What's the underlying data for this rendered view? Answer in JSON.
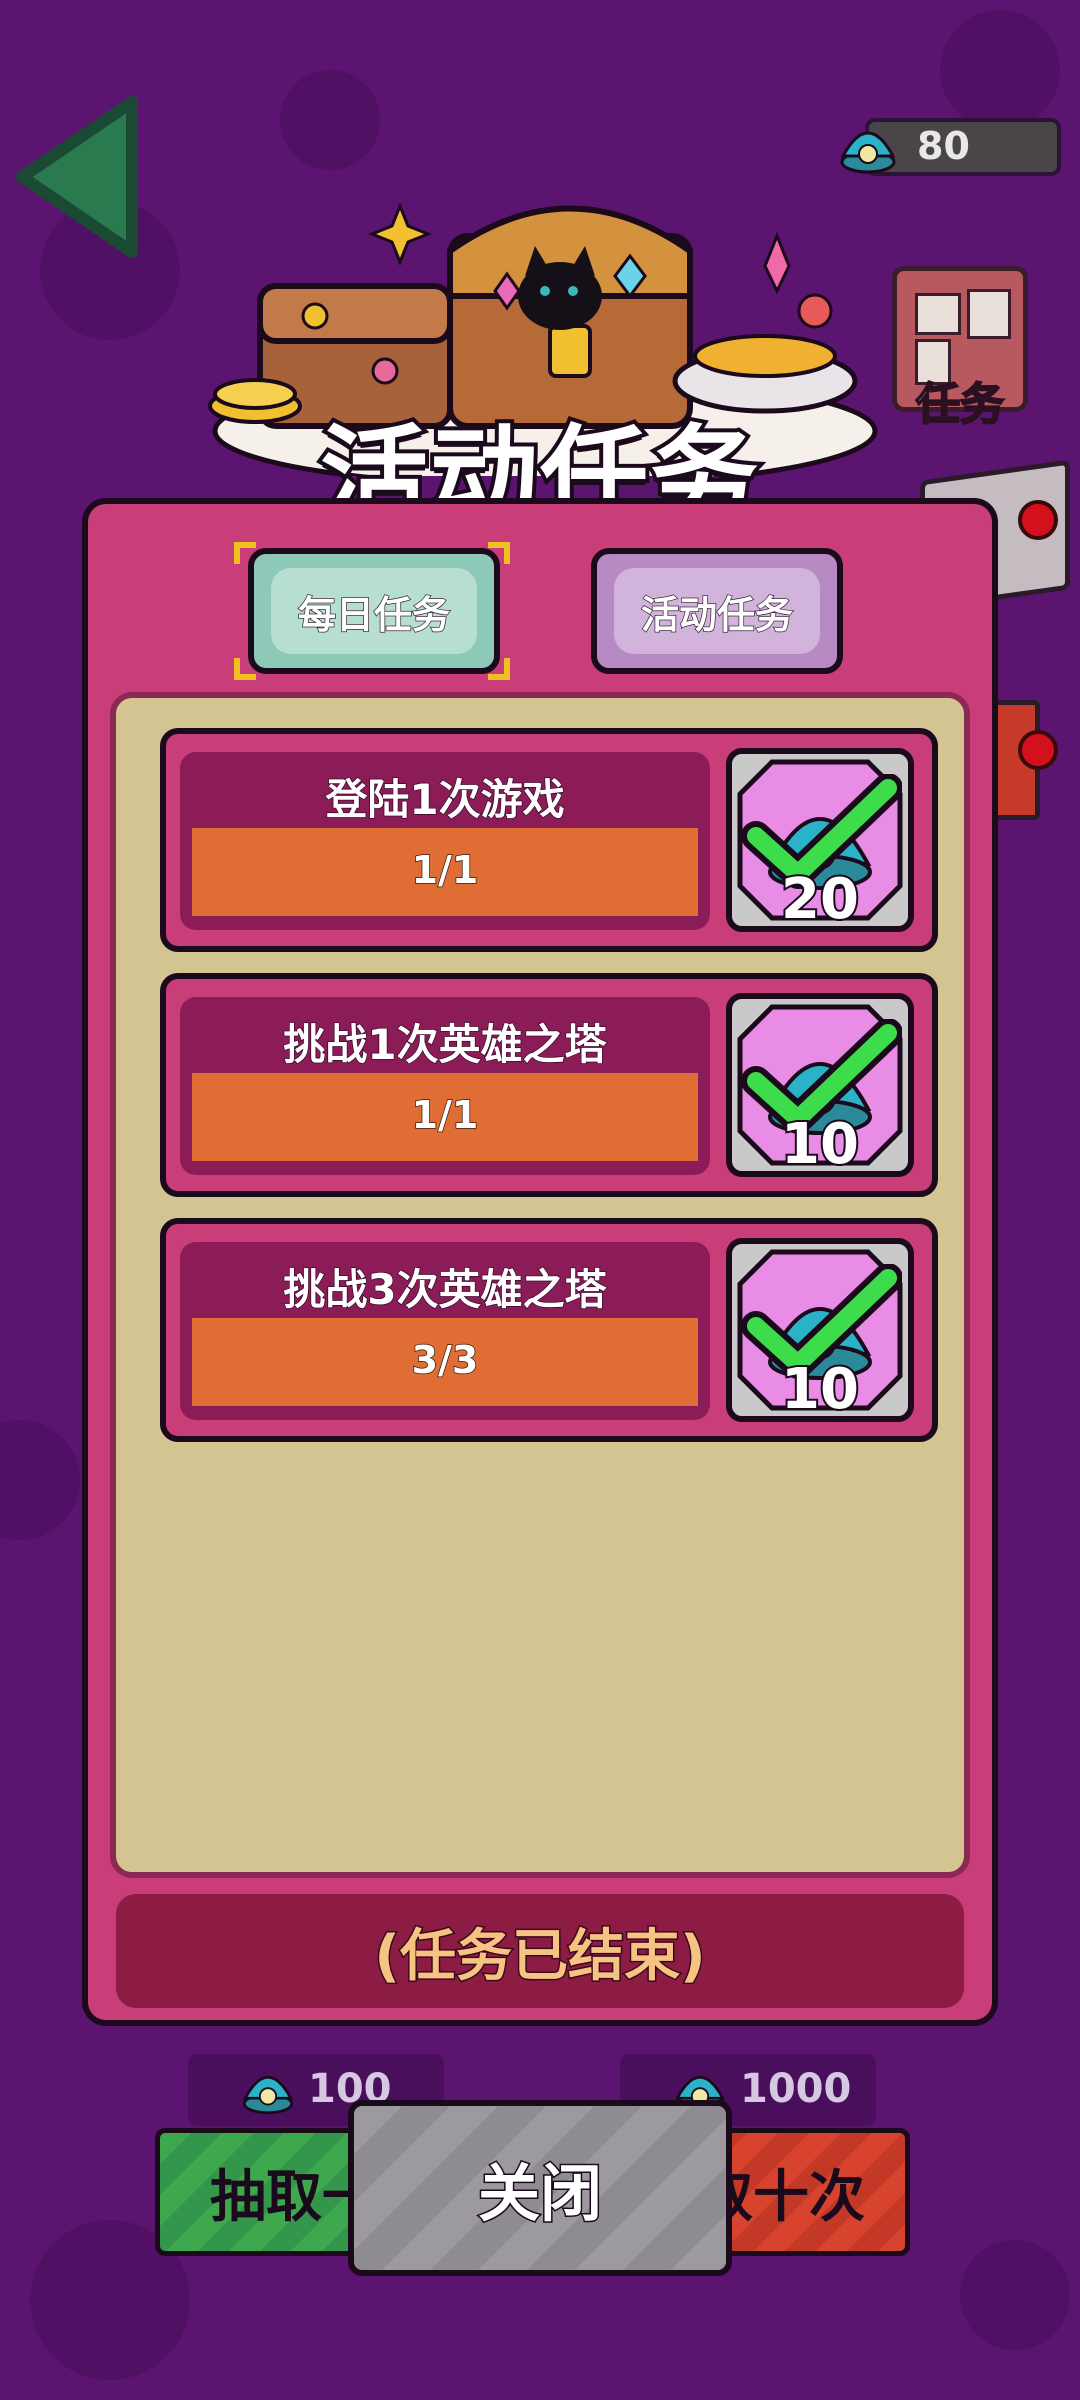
{
  "header": {
    "currency_value": "80",
    "side_task_label": "任务",
    "banner_title": "活动任务"
  },
  "tabs": [
    {
      "label": "每日任务",
      "selected": true
    },
    {
      "label": "活动任务",
      "selected": false
    }
  ],
  "tasks": [
    {
      "title": "登陆1次游戏",
      "progress": "1/1",
      "reward": "20",
      "completed": true
    },
    {
      "title": "挑战1次英雄之塔",
      "progress": "1/1",
      "reward": "10",
      "completed": true
    },
    {
      "title": "挑战3次英雄之塔",
      "progress": "3/3",
      "reward": "10",
      "completed": true
    }
  ],
  "status_text": "(任务已结束)",
  "bottom": {
    "draw_one_cost": "100",
    "draw_ten_cost": "1000",
    "draw_one_label": "抽取一",
    "draw_ten_label": "取十次",
    "close_label": "关闭"
  },
  "colors": {
    "background": "#5b1470",
    "panel": "#c93d79",
    "progress_bar": "#e06e34",
    "check": "#3ddc4a"
  }
}
